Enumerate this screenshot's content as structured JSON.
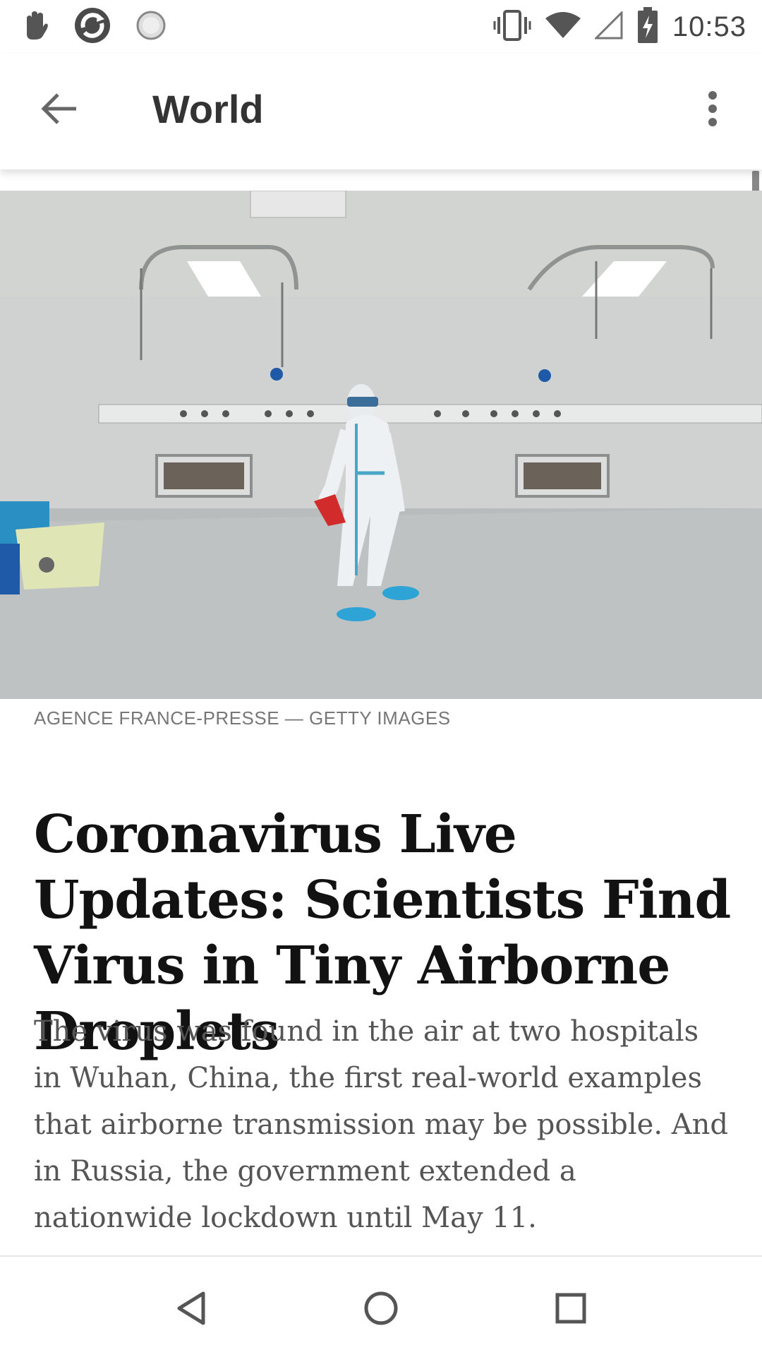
{
  "status_bar": {
    "time": "10:53",
    "left_icons": [
      "hand-notification-icon",
      "sync-app-icon",
      "circle-app-icon"
    ],
    "right_icons": [
      "vibrate-icon",
      "wifi-icon",
      "cell-signal-icon",
      "battery-charging-icon"
    ]
  },
  "app_bar": {
    "title": "World",
    "back_icon": "arrow-left-icon",
    "menu_icon": "more-vert-icon"
  },
  "article": {
    "image_alt": "Health worker in protective suit walking through a hospital ward",
    "image_credit": "AGENCE FRANCE-PRESSE — GETTY IMAGES",
    "headline": "Coronavirus Live Updates: Scientists Find Virus in Tiny Airborne Droplets",
    "summary": "The virus was found in the air at two hospitals in Wuhan, China, the first real-world examples that airborne transmission may be possible. And in Russia, the government extended a nationwide lockdown until May 11."
  },
  "nav_bar": {
    "buttons": [
      "back-triangle-icon",
      "home-circle-icon",
      "recents-square-icon"
    ]
  }
}
